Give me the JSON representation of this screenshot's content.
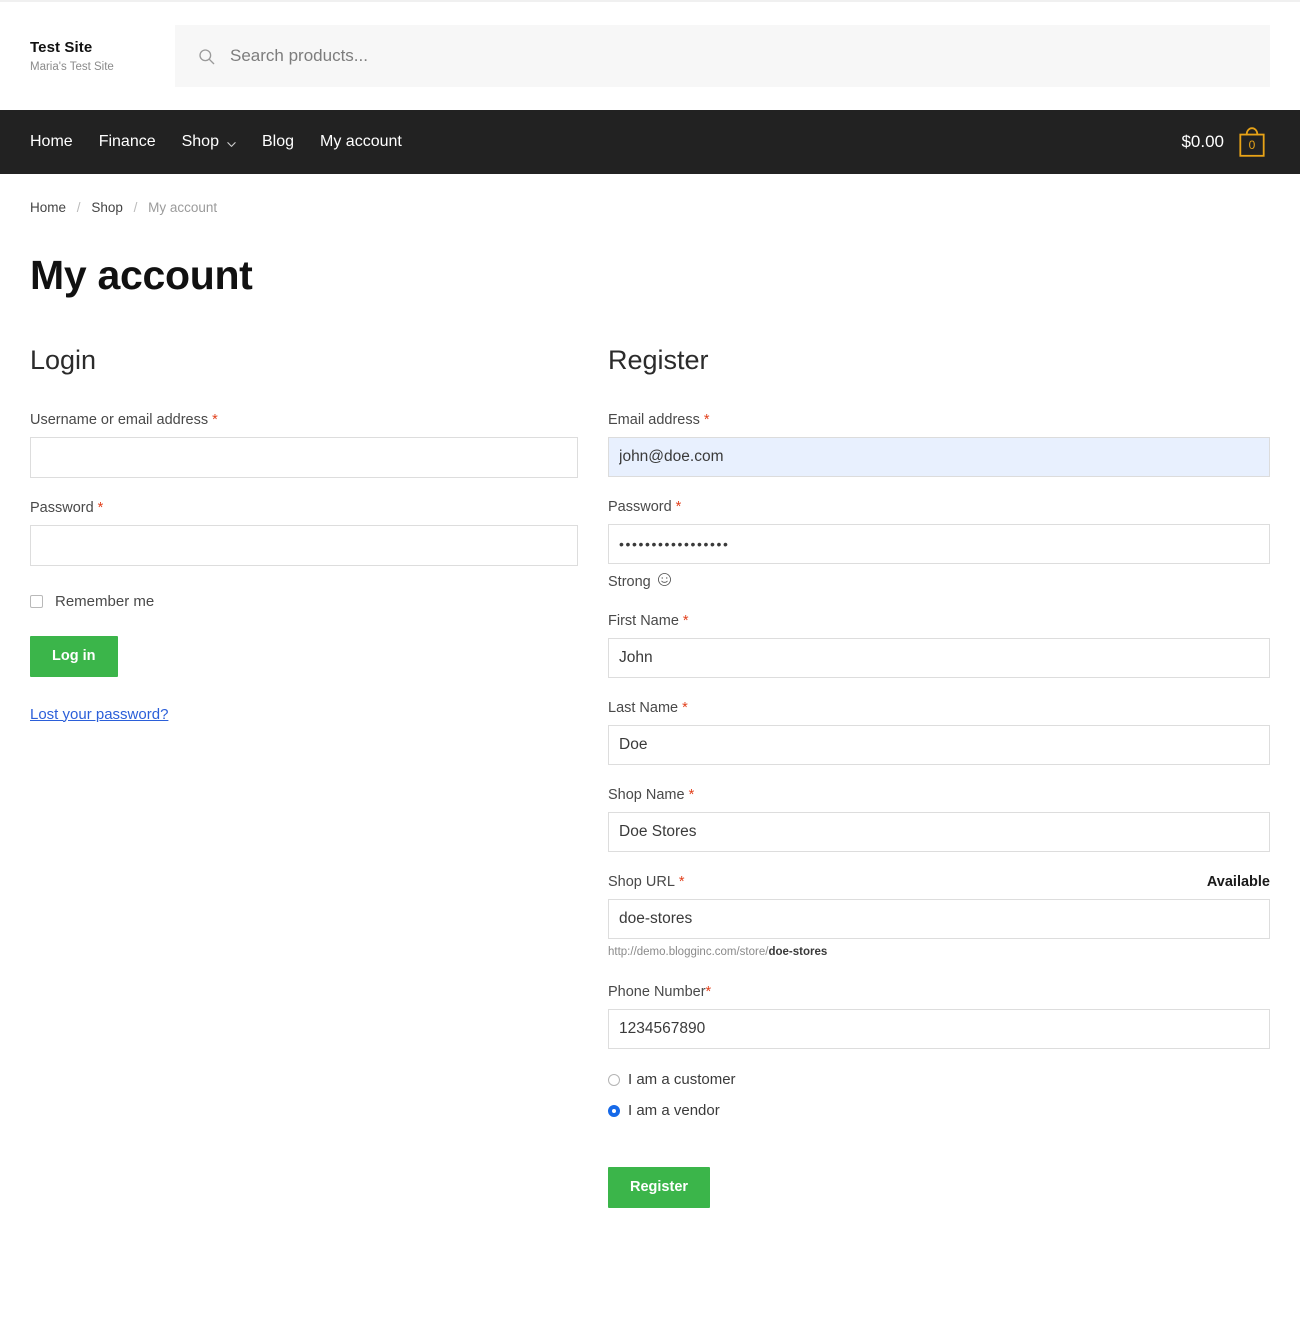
{
  "header": {
    "brand_title": "Test Site",
    "brand_subtitle": "Maria's Test Site",
    "search_placeholder": "Search products...",
    "search_value": "",
    "search_icon": "search-icon"
  },
  "nav": {
    "items": [
      {
        "label": "Home",
        "has_dropdown": false
      },
      {
        "label": "Finance",
        "has_dropdown": false
      },
      {
        "label": "Shop",
        "has_dropdown": true
      },
      {
        "label": "Blog",
        "has_dropdown": false
      },
      {
        "label": "My account",
        "has_dropdown": false
      }
    ],
    "cart": {
      "amount": "$0.00",
      "count": "0",
      "icon": "shopping-bag-icon",
      "accent_color": "#e8a317"
    },
    "background_color": "#222222"
  },
  "breadcrumb": {
    "items": [
      "Home",
      "Shop",
      "My account"
    ],
    "separator": "/"
  },
  "page": {
    "title": "My account"
  },
  "login": {
    "heading": "Login",
    "username": {
      "label": "Username or email address",
      "required": "*",
      "value": "",
      "placeholder": ""
    },
    "password": {
      "label": "Password",
      "required": "*",
      "value": "",
      "placeholder": ""
    },
    "remember": {
      "label": "Remember me",
      "checked": false
    },
    "submit_label": "Log in",
    "lost_password_label": "Lost your password?"
  },
  "register": {
    "heading": "Register",
    "email": {
      "label": "Email address",
      "required": "*",
      "value": "john@doe.com",
      "autofilled": true,
      "autofill_color": "#e8f0fe"
    },
    "password": {
      "label": "Password",
      "required": "*",
      "value": "•••••••••••••••••",
      "strength_text": "Strong",
      "strength_icon": "smiley-face-icon"
    },
    "first_name": {
      "label": "First Name",
      "required": "*",
      "value": "John"
    },
    "last_name": {
      "label": "Last Name",
      "required": "*",
      "value": "Doe"
    },
    "shop_name": {
      "label": "Shop Name",
      "required": "*",
      "value": "Doe Stores"
    },
    "shop_url": {
      "label": "Shop URL",
      "required": "*",
      "value": "doe-stores",
      "availability": "Available",
      "hint_prefix": "http://demo.blogginc.com/store/",
      "hint_slug": "doe-stores"
    },
    "phone": {
      "label": "Phone Number",
      "required": "*",
      "value": "1234567890"
    },
    "account_type": {
      "options": [
        {
          "label": "I am a customer",
          "selected": false
        },
        {
          "label": "I am a vendor",
          "selected": true
        }
      ],
      "selected_color": "#1669e8"
    },
    "submit_label": "Register"
  },
  "theme": {
    "button_green": "#3bb54a",
    "required_red": "#e2401c",
    "link_blue": "#2b5fd9"
  }
}
